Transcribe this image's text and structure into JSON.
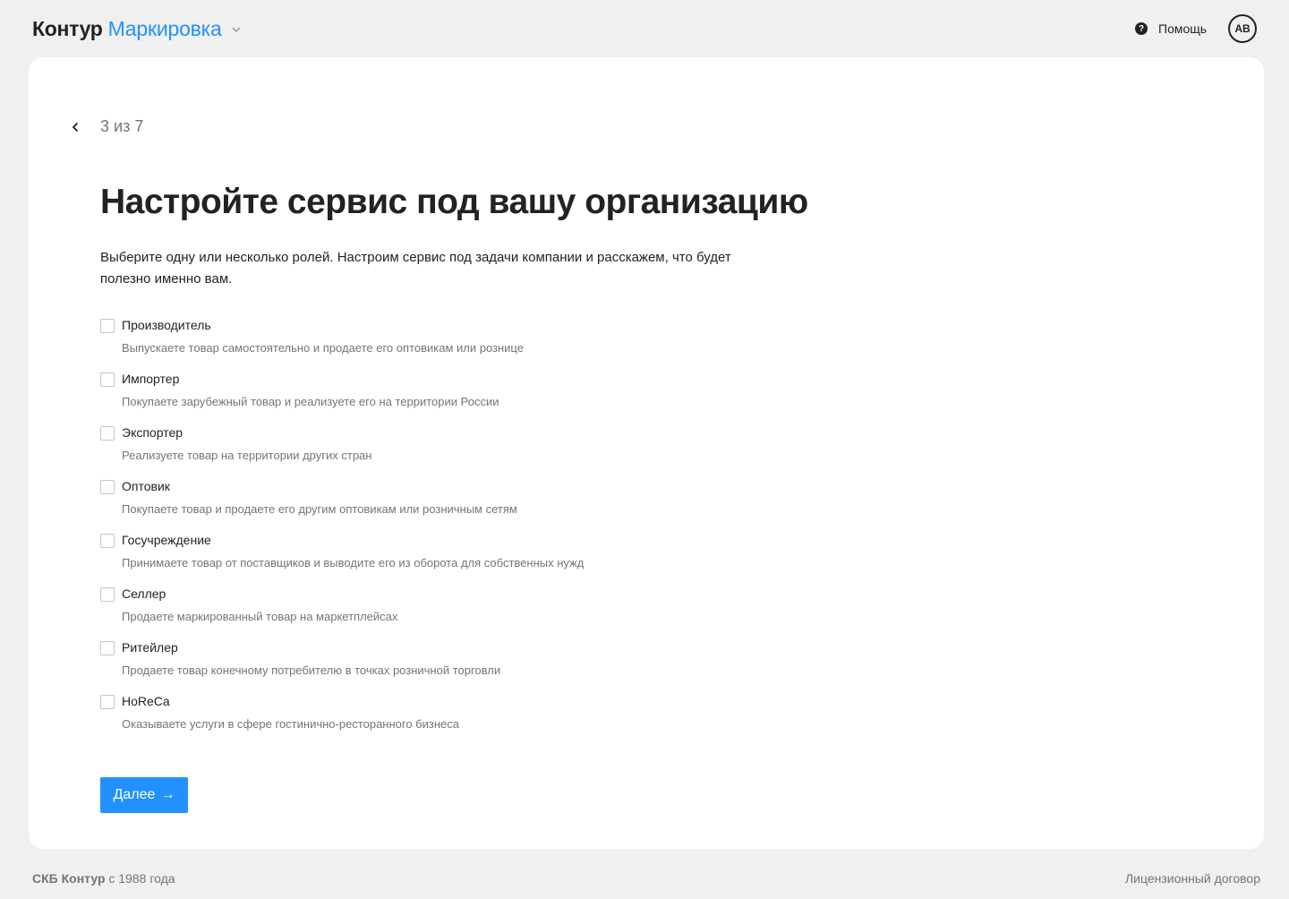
{
  "header": {
    "brand": "Контур",
    "product": "Маркировка",
    "help_label": "Помощь",
    "avatar_initials": "AB"
  },
  "wizard": {
    "step": "3 из 7",
    "title": "Настройте сервис под вашу организацию",
    "description": "Выберите одну или несколько ролей. Настроим сервис под задачи компании и расскажем, что будет полезно именно вам.",
    "roles": [
      {
        "name": "Производитель",
        "hint": "Выпускаете товар самостоятельно и продаете его оптовикам или рознице",
        "checked": false
      },
      {
        "name": "Импортер",
        "hint": "Покупаете зарубежный товар и реализуете его на территории России",
        "checked": false
      },
      {
        "name": "Экспортер",
        "hint": "Реализуете товар на территории других стран",
        "checked": false
      },
      {
        "name": "Оптовик",
        "hint": "Покупаете товар и продаете его другим оптовикам или розничным сетям",
        "checked": false
      },
      {
        "name": "Госучреждение",
        "hint": "Принимаете товар от поставщиков и выводите его из оборота для собственных нужд",
        "checked": false
      },
      {
        "name": "Селлер",
        "hint": "Продаете маркированный товар на маркетплейсах",
        "checked": false
      },
      {
        "name": "Ритейлер",
        "hint": "Продаете товар конечному потребителю в точках розничной торговли",
        "checked": false
      },
      {
        "name": "HoReCa",
        "hint": "Оказываете услуги в сфере гостинично-ресторанного бизнеса",
        "checked": false
      }
    ],
    "next_label": "Далее"
  },
  "footer": {
    "company": "СКБ Контур",
    "since": "с 1988 года",
    "license_link": "Лицензионный договор"
  },
  "colors": {
    "accent": "#2291ff",
    "background": "#f0f0f0",
    "card": "#ffffff",
    "text": "#222222",
    "muted": "#757575"
  }
}
